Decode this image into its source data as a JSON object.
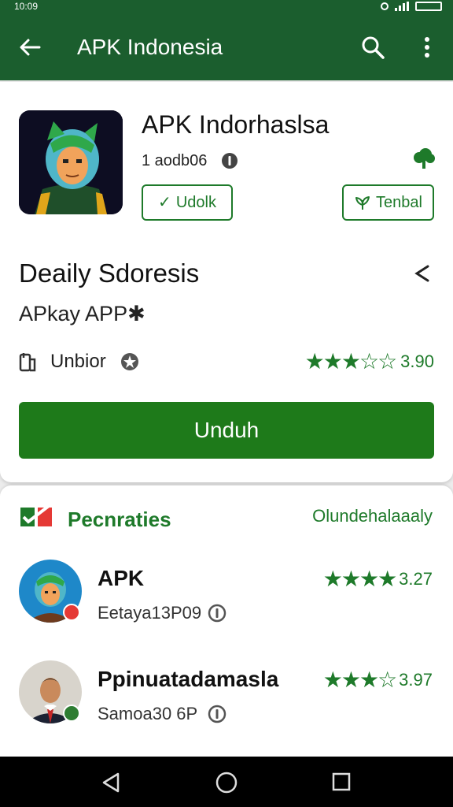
{
  "status_bar": {
    "time": "10:09"
  },
  "app_bar": {
    "title": "APK Indonesia"
  },
  "app": {
    "name": "APK Indorhaslsa",
    "id_text": "1 aodb06",
    "btn_left": "Udolk",
    "btn_right": "Tenbal"
  },
  "detail": {
    "title": "Deaily Sdoresis",
    "subtitle": "APkay APP",
    "meta_label": "Unbior",
    "rating_stars": "★★★☆☆",
    "rating_value": "3.90",
    "primary_button": "Unduh"
  },
  "section": {
    "title": "Pecnraties",
    "link": "Olundehalaaaly"
  },
  "list": [
    {
      "name": "APK",
      "sub": "Eetaya13P09",
      "stars": "★★★★",
      "rating": "3.27",
      "badge_color": "#e53935"
    },
    {
      "name": "Ppinuatadamaslа",
      "sub": "Samoa30 6P",
      "stars": "★★★☆",
      "rating": "3.97",
      "badge_color": "#2e7d32"
    }
  ],
  "colors": {
    "brand": "#1b5e2e",
    "accent": "#1e7a2a"
  },
  "icons": [
    "back-arrow-icon",
    "search-icon",
    "more-vert-icon",
    "info-icon",
    "cloud-tree-icon",
    "check-icon",
    "leaf-icon",
    "close-icon",
    "phone-icon",
    "badge-icon",
    "section-logo-icon",
    "nav-back-icon",
    "nav-home-icon",
    "nav-recent-icon"
  ]
}
